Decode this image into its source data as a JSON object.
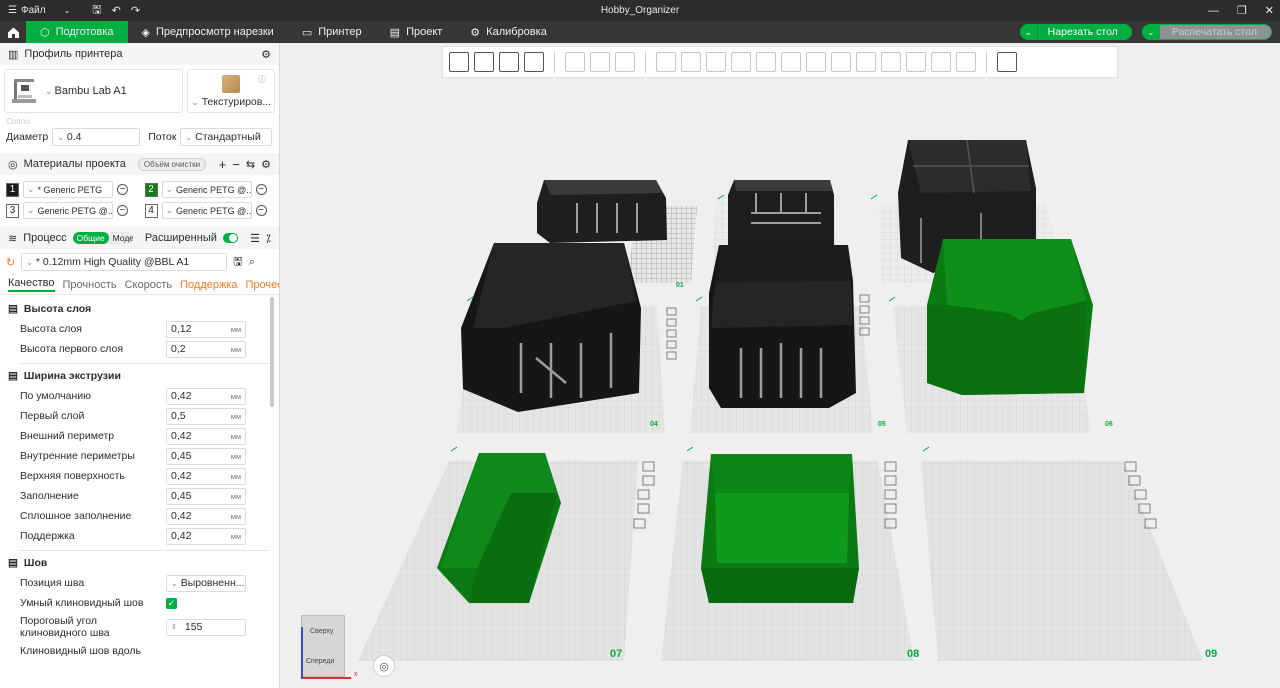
{
  "titlebar": {
    "menu_file": "Файл",
    "app_title": "Hobby_Organizer"
  },
  "nav": {
    "tabs": [
      {
        "label": "Подготовка",
        "icon": "cube-icon"
      },
      {
        "label": "Предпросмотр нарезки",
        "icon": "layers-icon"
      },
      {
        "label": "Принтер",
        "icon": "monitor-icon"
      },
      {
        "label": "Проект",
        "icon": "document-icon"
      },
      {
        "label": "Калибровка",
        "icon": "gear-icon"
      }
    ],
    "slice_label": "Нарезать стол",
    "print_label": "Распечатать стол"
  },
  "printer": {
    "section_title": "Профиль принтера",
    "name": "Bambu Lab A1",
    "plate": "Текстуриров...",
    "nozzle_group_label": "Сопло",
    "diameter_label": "Диаметр",
    "diameter_value": "0.4",
    "flow_label": "Поток",
    "flow_value": "Стандартный"
  },
  "filaments": {
    "section_title": "Материалы проекта",
    "flush_label": "Объём очистки",
    "items": [
      {
        "num": "1",
        "name": "* Generic PETG",
        "color": "#1b1b1b"
      },
      {
        "num": "2",
        "name": "Generic PETG @...",
        "color": "#0f7e1a"
      },
      {
        "num": "3",
        "name": "Generic PETG @...",
        "color": "#ffffff"
      },
      {
        "num": "4",
        "name": "Generic PETG @...",
        "color": "#ffffff"
      }
    ]
  },
  "process": {
    "section_title": "Процесс",
    "mode_global": "Общие",
    "mode_objects": "Модели",
    "advanced_label": "Расширенный",
    "advanced_on": true,
    "preset": "* 0.12mm High Quality @BBL A1",
    "tabs": [
      "Качество",
      "Прочность",
      "Скорость",
      "Поддержка",
      "Прочее"
    ],
    "groups": {
      "layer_height": {
        "title": "Высота слоя",
        "rows": [
          {
            "name": "Высота слоя",
            "value": "0,12",
            "unit": "мм"
          },
          {
            "name": "Высота первого слоя",
            "value": "0,2",
            "unit": "мм"
          }
        ]
      },
      "line_width": {
        "title": "Ширина экструзии",
        "rows": [
          {
            "name": "По умолчанию",
            "value": "0,42",
            "unit": "мм"
          },
          {
            "name": "Первый слой",
            "value": "0,5",
            "unit": "мм"
          },
          {
            "name": "Внешний периметр",
            "value": "0,42",
            "unit": "мм"
          },
          {
            "name": "Внутренние периметры",
            "value": "0,45",
            "unit": "мм"
          },
          {
            "name": "Верхняя поверхность",
            "value": "0,42",
            "unit": "мм"
          },
          {
            "name": "Заполнение",
            "value": "0,45",
            "unit": "мм"
          },
          {
            "name": "Сплошное заполнение",
            "value": "0,42",
            "unit": "мм"
          },
          {
            "name": "Поддержка",
            "value": "0,42",
            "unit": "мм"
          }
        ]
      },
      "seam": {
        "title": "Шов",
        "position_label": "Позиция шва",
        "position_value": "Выровненн...",
        "smart_scarf_label": "Умный клиновидный шов",
        "smart_scarf_checked": true,
        "angle_label_1": "Пороговый угол",
        "angle_label_2": "клиновидного шва",
        "angle_value": "155",
        "cut_label": "Клиновидный шов вдоль"
      }
    }
  },
  "viewport": {
    "plate_numbers": [
      "01",
      "04",
      "05",
      "06",
      "07",
      "08",
      "09"
    ],
    "view_cube_top": "Сверху",
    "view_cube_front": "Спереди",
    "axis_x_label": "x",
    "colors": {
      "accent": "#00ae42",
      "green_part": "#0b7a12",
      "black_part": "#1e1e1e"
    }
  }
}
